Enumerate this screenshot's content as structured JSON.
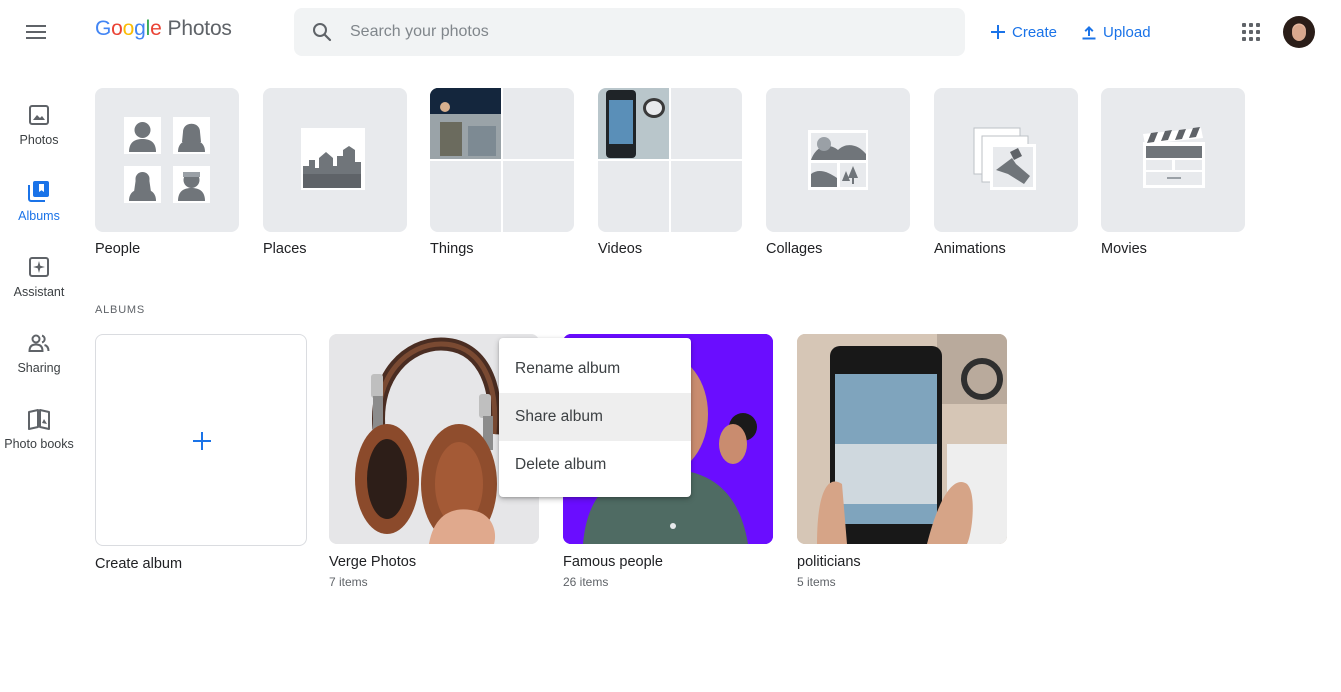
{
  "header": {
    "logo_google": [
      "G",
      "o",
      "o",
      "g",
      "l",
      "e"
    ],
    "logo_product": "Photos",
    "search_placeholder": "Search your photos",
    "create_label": "Create",
    "upload_label": "Upload"
  },
  "nav": {
    "items": [
      {
        "label": "Photos",
        "icon": "photo-icon"
      },
      {
        "label": "Albums",
        "icon": "albums-icon",
        "active": true
      },
      {
        "label": "Assistant",
        "icon": "assistant-icon"
      },
      {
        "label": "Sharing",
        "icon": "sharing-icon"
      },
      {
        "label": "Photo books",
        "icon": "photo-book-icon"
      }
    ]
  },
  "categories": [
    {
      "label": "People"
    },
    {
      "label": "Places"
    },
    {
      "label": "Things"
    },
    {
      "label": "Videos"
    },
    {
      "label": "Collages"
    },
    {
      "label": "Animations"
    },
    {
      "label": "Movies"
    }
  ],
  "albums_section": {
    "title": "ALBUMS",
    "create_label": "Create album",
    "albums": [
      {
        "title": "Verge Photos",
        "count": "7 items"
      },
      {
        "title": "Famous people",
        "count": "26 items"
      },
      {
        "title": "politicians",
        "count": "5 items"
      }
    ]
  },
  "context_menu": {
    "items": [
      "Rename album",
      "Share album",
      "Delete album"
    ]
  },
  "colors": {
    "accent": "#1a73e8",
    "tile_bg": "#e8eaed",
    "famous_bg": "#6a0dff"
  }
}
